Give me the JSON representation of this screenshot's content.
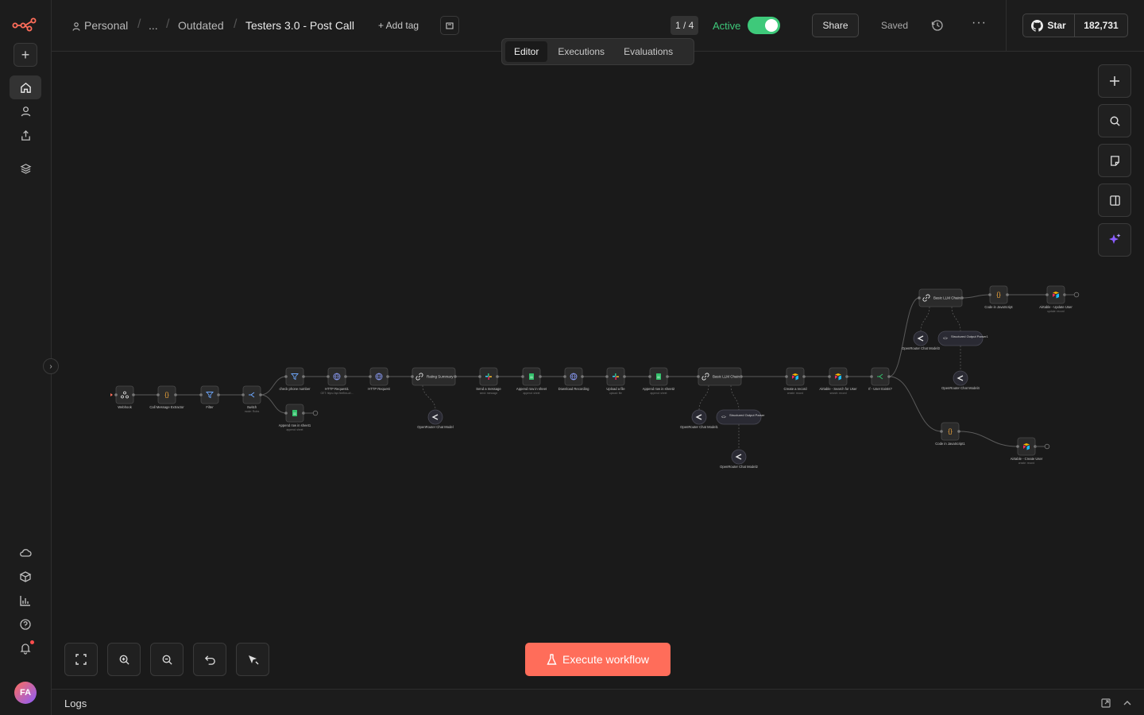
{
  "breadcrumb": {
    "owner": "Personal",
    "ellipsis": "...",
    "folder": "Outdated",
    "workflow_title": "Testers 3.0 - Post Call",
    "add_tag": "+ Add tag"
  },
  "header": {
    "version_counter": "1 / 4",
    "active_label": "Active",
    "active": true,
    "share_label": "Share",
    "saved_label": "Saved",
    "more_label": "···",
    "github_star_label": "Star",
    "github_star_count": "182,731"
  },
  "view_tabs": [
    {
      "label": "Editor",
      "selected": true
    },
    {
      "label": "Executions",
      "selected": false
    },
    {
      "label": "Evaluations",
      "selected": false
    }
  ],
  "sidebar": {
    "avatar_initials": "FA",
    "items": [
      "home-icon",
      "user-icon",
      "share-icon",
      "layers-icon"
    ],
    "footer_items": [
      "cloud-icon",
      "templates-icon",
      "insights-icon",
      "help-icon",
      "bell-icon"
    ]
  },
  "canvas_controls": {
    "right": [
      "plus-icon",
      "search-icon",
      "sticky-note-icon",
      "panel-icon",
      "ai-sparkle-icon"
    ],
    "bottom": [
      "fit-view-icon",
      "zoom-in-icon",
      "zoom-out-icon",
      "undo-icon",
      "tidy-icon"
    ]
  },
  "execute_label": "Execute workflow",
  "logs_label": "Logs",
  "colors": {
    "accent": "#ff6d5a",
    "active_green": "#3ec97a",
    "canvas_bg": "#1a1a1a"
  },
  "nodes": [
    {
      "id": "webhook",
      "label": "Webhook",
      "sub": "",
      "icon": "webhook-icon",
      "color": "#e8e8e8"
    },
    {
      "id": "extract",
      "label": "Call Message Extractor",
      "sub": "",
      "icon": "code-icon",
      "color": "#f0a63a"
    },
    {
      "id": "filter",
      "label": "Filter",
      "sub": "",
      "icon": "filter-icon",
      "color": "#6ea8ff"
    },
    {
      "id": "switch",
      "label": "Switch",
      "sub": "mode: Rules",
      "icon": "switch-icon",
      "color": "#6ea8ff"
    },
    {
      "id": "check",
      "label": "check phone number",
      "sub": "",
      "icon": "filter-icon",
      "color": "#6ea8ff"
    },
    {
      "id": "append1",
      "label": "Append row in sheet1",
      "sub": "append: sheet",
      "icon": "sheets-icon",
      "color": "#33c16b"
    },
    {
      "id": "http1",
      "label": "HTTP Request1",
      "sub": "GET: https://api.fireflies.ai/...",
      "icon": "globe-icon",
      "color": "#8ea0ff"
    },
    {
      "id": "http2",
      "label": "HTTP Request",
      "sub": "",
      "icon": "globe-icon",
      "color": "#8ea0ff"
    },
    {
      "id": "rating",
      "label": "Rating Summary",
      "sub": "",
      "icon": "chain-icon",
      "color": "#e8e8e8"
    },
    {
      "id": "or0",
      "label": "OpenRouter Chat Model",
      "sub": "",
      "icon": "openrouter-icon",
      "color": "#e8e8e8"
    },
    {
      "id": "slack1",
      "label": "Send a message",
      "sub": "send: message",
      "icon": "slack-icon",
      "color": "#e0457b"
    },
    {
      "id": "append2",
      "label": "Append row in sheet",
      "sub": "append: sheet",
      "icon": "sheets-icon",
      "color": "#33c16b"
    },
    {
      "id": "download",
      "label": "Download Recording",
      "sub": "",
      "icon": "globe-icon",
      "color": "#8ea0ff"
    },
    {
      "id": "slack2",
      "label": "Upload a file",
      "sub": "upload: file",
      "icon": "slack-icon",
      "color": "#e0457b"
    },
    {
      "id": "append3",
      "label": "Append row in sheet2",
      "sub": "append: sheet",
      "icon": "sheets-icon",
      "color": "#33c16b"
    },
    {
      "id": "llm1",
      "label": "Basic LLM Chain",
      "sub": "",
      "icon": "chain-icon",
      "color": "#e8e8e8"
    },
    {
      "id": "or1",
      "label": "OpenRouter Chat Model1",
      "sub": "",
      "icon": "openrouter-icon",
      "color": "#e8e8e8"
    },
    {
      "id": "sop1",
      "label": "Structured Output Parser",
      "sub": "",
      "icon": "code-bracket-icon",
      "color": "#e8e8e8"
    },
    {
      "id": "or2",
      "label": "OpenRouter Chat Model2",
      "sub": "",
      "icon": "openrouter-icon",
      "color": "#e8e8e8"
    },
    {
      "id": "create",
      "label": "Create a record",
      "sub": "create: record",
      "icon": "airtable-icon",
      "color": "#f5c02b"
    },
    {
      "id": "search",
      "label": "Airtable - Search for User",
      "sub": "search: record",
      "icon": "airtable-icon",
      "color": "#f5c02b"
    },
    {
      "id": "ifuser",
      "label": "If - User Exists?",
      "sub": "",
      "icon": "if-icon",
      "color": "#33c16b"
    },
    {
      "id": "llm2",
      "label": "Basic LLM Chain1",
      "sub": "",
      "icon": "chain-icon",
      "color": "#e8e8e8"
    },
    {
      "id": "or3",
      "label": "OpenRouter Chat Model3",
      "sub": "",
      "icon": "openrouter-icon",
      "color": "#e8e8e8"
    },
    {
      "id": "sop2",
      "label": "Structured Output Parser1",
      "sub": "",
      "icon": "code-bracket-icon",
      "color": "#e8e8e8"
    },
    {
      "id": "or4",
      "label": "OpenRouter Chat Model4",
      "sub": "",
      "icon": "openrouter-icon",
      "color": "#e8e8e8"
    },
    {
      "id": "code1",
      "label": "Code in JavaScript",
      "sub": "",
      "icon": "code-icon",
      "color": "#f0a63a"
    },
    {
      "id": "update",
      "label": "Airtable - Update User",
      "sub": "update: record",
      "icon": "airtable-icon",
      "color": "#f5c02b"
    },
    {
      "id": "code2",
      "label": "Code in JavaScript1",
      "sub": "",
      "icon": "code-icon",
      "color": "#f0a63a"
    },
    {
      "id": "createuser",
      "label": "Airtable - Create User",
      "sub": "create: record",
      "icon": "airtable-icon",
      "color": "#f5c02b"
    }
  ]
}
